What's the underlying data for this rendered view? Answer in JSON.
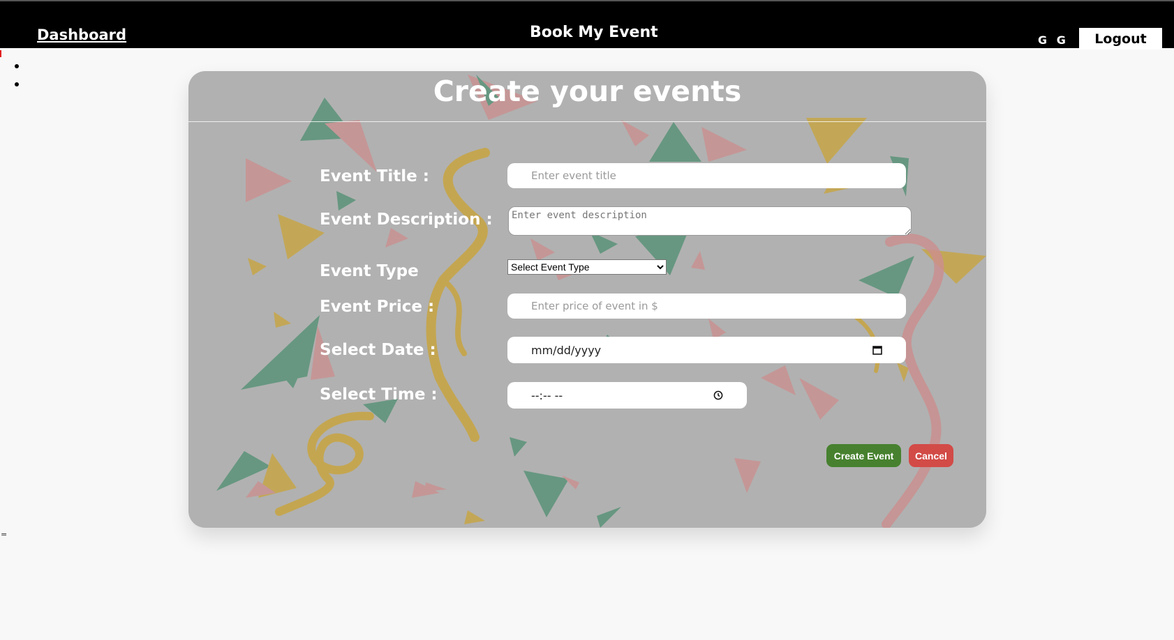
{
  "header": {
    "dashboard_link": "Dashboard",
    "brand": "Book My Event",
    "user_initials": "G G",
    "logout_label": "Logout"
  },
  "form": {
    "title": "Create your events",
    "fields": {
      "title": {
        "label": "Event Title :",
        "placeholder": "Enter event title"
      },
      "description": {
        "label": "Event Description :",
        "placeholder": "Enter event description"
      },
      "type": {
        "label": "Event Type",
        "selected": "Select Event Type"
      },
      "price": {
        "label": "Event Price :",
        "placeholder": "Enter price of event in $"
      },
      "date": {
        "label": "Select Date :",
        "value": "mm/dd/yyyy"
      },
      "time": {
        "label": "Select Time :",
        "value": "--:-- --"
      }
    },
    "actions": {
      "create_label": "Create Event",
      "cancel_label": "Cancel"
    }
  },
  "colors": {
    "create_button": "#47812f",
    "cancel_button": "#d24b47",
    "card_background": "#b1b1b1",
    "confetti_green": "#4f8f72",
    "confetti_pink": "#cc8e8e",
    "confetti_gold": "#c9a43a"
  }
}
